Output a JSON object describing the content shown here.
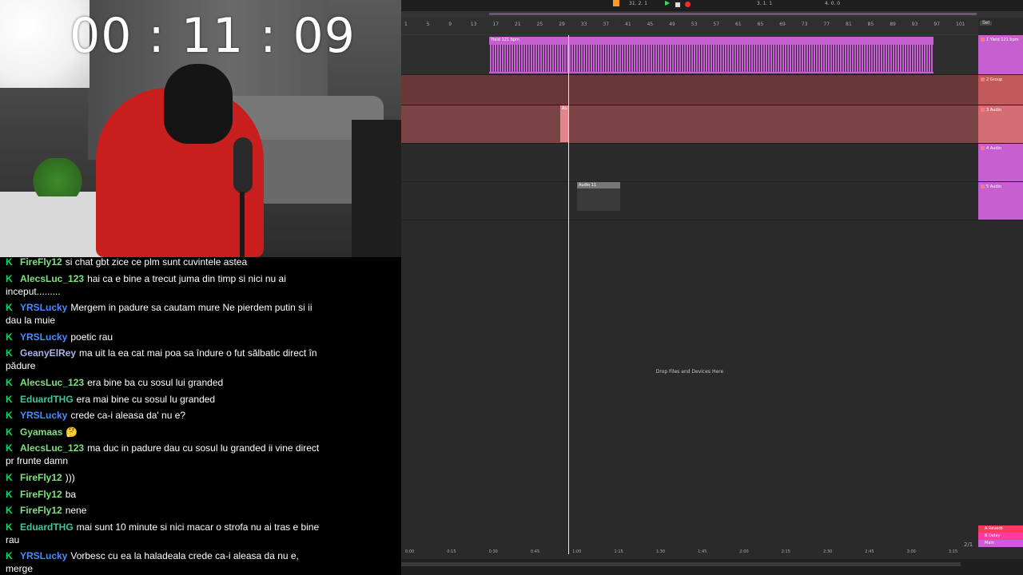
{
  "timer": "00 : 11 : 09",
  "chat": [
    {
      "user": "FireFly12",
      "color": "#7fe07f",
      "text": "si chat gbt zice ce plm sunt cuvintele astea"
    },
    {
      "user": "AlecsLuc_123",
      "color": "#7fe07f",
      "text": "hai ca e bine a trecut juma din timp si nici nu ai inceput........."
    },
    {
      "user": "YRSLucky",
      "color": "#4a8cff",
      "text": "Mergem in padure sa cautam mure Ne pierdem putin si ii dau la muie"
    },
    {
      "user": "YRSLucky",
      "color": "#4a8cff",
      "text": "poetic rau"
    },
    {
      "user": "GeanyElRey",
      "color": "#a9b5e8",
      "text": "ma uit la ea cat mai poa sa îndure o fut sălbatic direct în pădure"
    },
    {
      "user": "AlecsLuc_123",
      "color": "#7fe07f",
      "text": "era bine ba cu sosul lui granded"
    },
    {
      "user": "EduardTHG",
      "color": "#3fc89a",
      "text": "era mai bine cu sosul lu granded"
    },
    {
      "user": "YRSLucky",
      "color": "#4a8cff",
      "text": "crede ca-i aleasa da' nu e?"
    },
    {
      "user": "Gyamaas",
      "color": "#7fe07f",
      "text": "🤔"
    },
    {
      "user": "AlecsLuc_123",
      "color": "#7fe07f",
      "text": "ma duc in padure dau cu sosul lu granded ii vine direct pr frunte damn"
    },
    {
      "user": "FireFly12",
      "color": "#7fe07f",
      "text": ")))"
    },
    {
      "user": "FireFly12",
      "color": "#7fe07f",
      "text": "ba"
    },
    {
      "user": "FireFly12",
      "color": "#7fe07f",
      "text": "nene"
    },
    {
      "user": "EduardTHG",
      "color": "#3fc89a",
      "text": "mai sunt 10 minute si nici macar o strofa nu ai tras e bine rau"
    },
    {
      "user": "YRSLucky",
      "color": "#4a8cff",
      "text": "Vorbesc cu ea la haladeala crede ca-i aleasa da nu e, merge"
    }
  ],
  "daw": {
    "transport_position": "31. 2. 1",
    "loop_start": "3. 1. 1",
    "loop_length": "4. 0. 0",
    "set_label": "Set",
    "bars": [
      "1",
      "5",
      "9",
      "13",
      "17",
      "21",
      "25",
      "29",
      "33",
      "37",
      "41",
      "45",
      "49",
      "53",
      "57",
      "61",
      "65",
      "69",
      "73",
      "77",
      "81",
      "85",
      "89",
      "93",
      "97",
      "101"
    ],
    "tracks": [
      {
        "name": "1 Yield 121 bpm",
        "color": "#c65fd0",
        "clip_name": "Yield 121 bpm"
      },
      {
        "name": "2 Group",
        "color": "#c35a5a"
      },
      {
        "name": "3 Audio",
        "color": "#d36f74",
        "clip_name": "Au"
      },
      {
        "name": "4 Audio",
        "color": "#c65fd0"
      },
      {
        "name": "5 Audio",
        "color": "#c65fd0",
        "clip_name": "Audio 11"
      }
    ],
    "drop_text": "Drop Files and Devices Here",
    "returns": [
      {
        "name": "A Reverb",
        "color": "#ff3a5c"
      },
      {
        "name": "B Delay",
        "color": "#ff3aa3"
      },
      {
        "name": "Main",
        "color": "#d05adc"
      }
    ],
    "timeline": [
      "0:00",
      "0:15",
      "0:30",
      "0:45",
      "1:00",
      "1:15",
      "1:30",
      "1:45",
      "2:00",
      "2:15",
      "2:30",
      "2:45",
      "3:00",
      "3:15"
    ],
    "page_indicator": "2/1"
  }
}
